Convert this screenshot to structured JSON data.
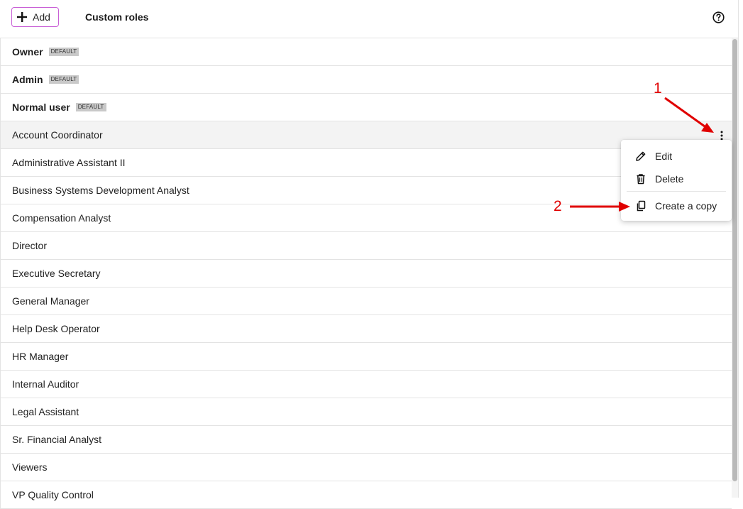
{
  "header": {
    "add_label": "Add",
    "title": "Custom roles"
  },
  "roles": [
    {
      "name": "Owner",
      "badge": "DEFAULT"
    },
    {
      "name": "Admin",
      "badge": "DEFAULT"
    },
    {
      "name": "Normal user",
      "badge": "DEFAULT"
    },
    {
      "name": "Account Coordinator"
    },
    {
      "name": "Administrative Assistant II"
    },
    {
      "name": "Business Systems Development Analyst"
    },
    {
      "name": "Compensation Analyst"
    },
    {
      "name": "Director"
    },
    {
      "name": "Executive Secretary"
    },
    {
      "name": "General Manager"
    },
    {
      "name": "Help Desk Operator"
    },
    {
      "name": "HR Manager"
    },
    {
      "name": "Internal Auditor"
    },
    {
      "name": "Legal Assistant"
    },
    {
      "name": "Sr. Financial Analyst"
    },
    {
      "name": "Viewers"
    },
    {
      "name": "VP Quality Control"
    }
  ],
  "context_menu": {
    "edit_label": "Edit",
    "delete_label": "Delete",
    "copy_label": "Create a copy"
  },
  "annotations": {
    "step1": "1",
    "step2": "2"
  },
  "colors": {
    "add_border": "#c85fd6",
    "annotation": "#e00000",
    "hover_row": "#f3f3f3",
    "badge_bg": "#c9c9c9"
  },
  "icons": [
    "plus-icon",
    "help-circle-icon",
    "kebab-menu-icon",
    "pencil-icon",
    "trash-icon",
    "copy-icon"
  ]
}
